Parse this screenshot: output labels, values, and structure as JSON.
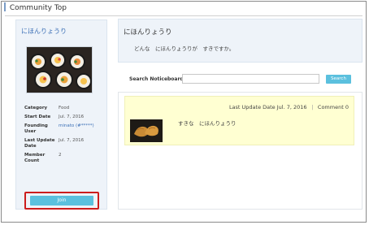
{
  "page": {
    "title": "Community Top"
  },
  "sidebar": {
    "community_name": "にほんりょうり",
    "info": [
      {
        "key": "Category",
        "value": "Food"
      },
      {
        "key": "Start Date",
        "value": "Jul. 7, 2016"
      },
      {
        "key": "Founding User",
        "value": "minato (#*****)"
      },
      {
        "key": "Last Update Date",
        "value": "Jul. 7, 2016"
      },
      {
        "key": "Member Count",
        "value": "2"
      }
    ],
    "join_label": "Join"
  },
  "top_card": {
    "title": "にほんりょうり",
    "description": "どんな　にほんりょうりが　すきですか。"
  },
  "search": {
    "label": "Search Noticeboard",
    "input_value": "",
    "button_label": "Search"
  },
  "post": {
    "last_update_label": "Last Update Date",
    "last_update_value": "Jul. 7, 2016",
    "separator": "|",
    "comment_label": "Comment",
    "comment_count": "0",
    "text": "すきな　にほんりょうり"
  },
  "colors": {
    "accent": "#5bc0de",
    "link": "#3b6fb6",
    "highlight": "#cc1d1d",
    "post_bg": "#ffffd2",
    "panel_bg": "#eef3f9"
  }
}
